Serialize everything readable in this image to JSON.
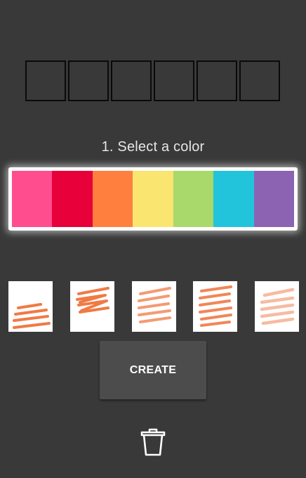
{
  "slots": {
    "count": 6
  },
  "step": {
    "title": "1. Select a color"
  },
  "palette": {
    "colors": [
      "#ff4d8d",
      "#e8003a",
      "#ff7f3f",
      "#f9e56f",
      "#a8d96a",
      "#22c4dc",
      "#8c63b3"
    ]
  },
  "styles": {
    "stroke_color": "#f07a45",
    "items": [
      {
        "name": "spiral-style-1",
        "opacity": 1.0
      },
      {
        "name": "spiral-style-2",
        "opacity": 1.0
      },
      {
        "name": "spiral-style-3",
        "opacity": 0.75
      },
      {
        "name": "spiral-style-4",
        "opacity": 0.9
      },
      {
        "name": "spiral-style-5",
        "opacity": 0.5
      }
    ]
  },
  "actions": {
    "create_label": "CREATE",
    "trash_icon": "trash-icon"
  }
}
